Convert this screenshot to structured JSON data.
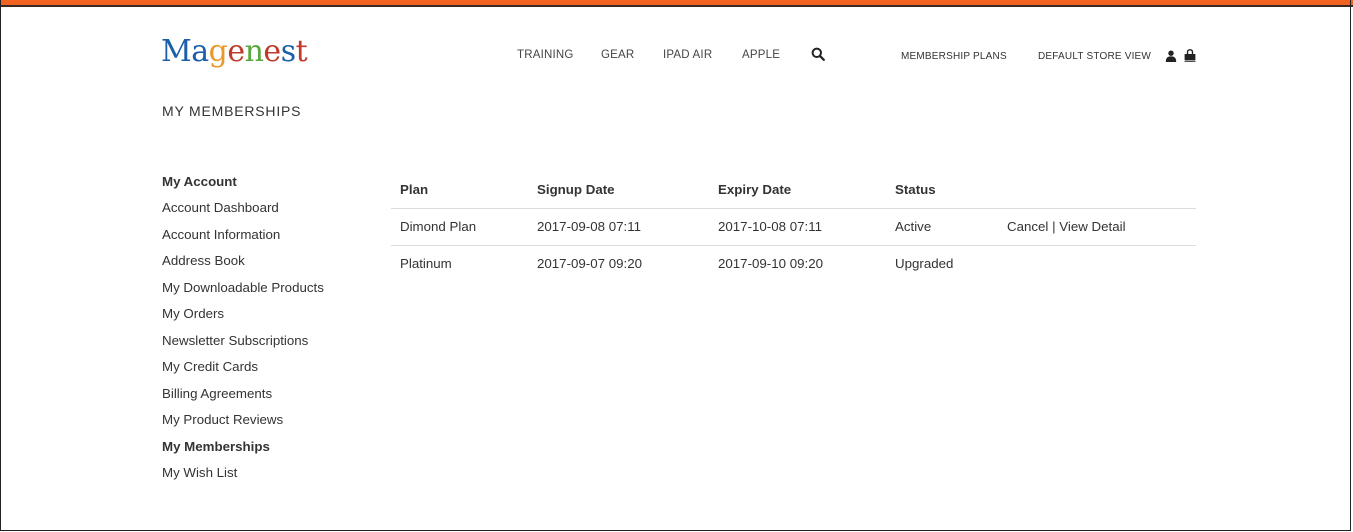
{
  "brand": {
    "logo_letters": [
      "M",
      "a",
      "g",
      "e",
      "n",
      "e",
      "s",
      "t"
    ],
    "logo_colors": [
      "#1b5faa",
      "#1b5faa",
      "#e8992a",
      "#c03a2b",
      "#5aa83c",
      "#c03a2b",
      "#1b5faa",
      "#c03a2b"
    ]
  },
  "nav": {
    "items": [
      "TRAINING",
      "GEAR",
      "IPAD AIR",
      "APPLE"
    ],
    "search_icon": "search-icon",
    "membership_plans": "MEMBERSHIP PLANS",
    "store_view": "DEFAULT STORE VIEW",
    "user_icon": "user-icon",
    "cart_icon": "shopping-bag-icon"
  },
  "page": {
    "title": "MY MEMBERSHIPS"
  },
  "sidebar": {
    "title": "My Account",
    "items": [
      {
        "label": "Account Dashboard",
        "active": false
      },
      {
        "label": "Account Information",
        "active": false
      },
      {
        "label": "Address Book",
        "active": false
      },
      {
        "label": "My Downloadable Products",
        "active": false
      },
      {
        "label": "My Orders",
        "active": false
      },
      {
        "label": "Newsletter Subscriptions",
        "active": false
      },
      {
        "label": "My Credit Cards",
        "active": false
      },
      {
        "label": "Billing Agreements",
        "active": false
      },
      {
        "label": "My Product Reviews",
        "active": false
      },
      {
        "label": "My Memberships",
        "active": true
      },
      {
        "label": "My Wish List",
        "active": false
      }
    ]
  },
  "table": {
    "headers": [
      "Plan",
      "Signup Date",
      "Expiry Date",
      "Status"
    ],
    "rows": [
      {
        "plan": "Dimond Plan",
        "signup": "2017-09-08 07:11",
        "expiry": "2017-10-08 07:11",
        "status": "Active",
        "cancel": "Cancel",
        "separator": "|",
        "view": "View Detail"
      },
      {
        "plan": "Platinum",
        "signup": "2017-09-07 09:20",
        "expiry": "2017-09-10 09:20",
        "status": "Upgraded",
        "cancel": "",
        "separator": "",
        "view": ""
      }
    ]
  },
  "colors": {
    "accent_bar": "#f26322"
  }
}
